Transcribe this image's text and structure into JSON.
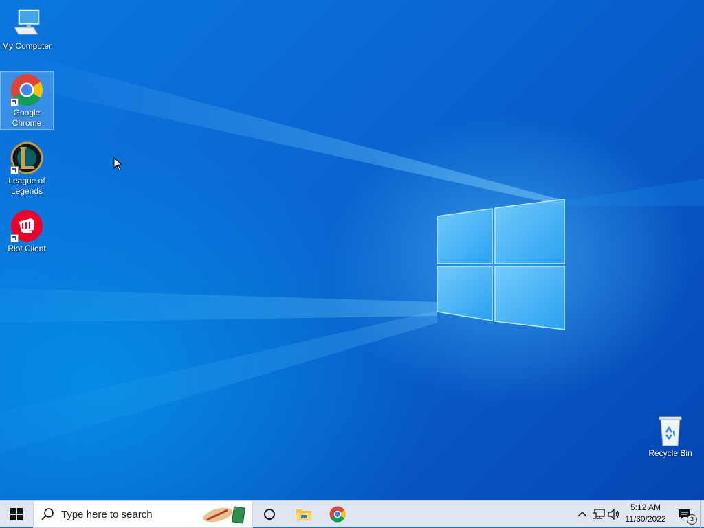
{
  "desktop": {
    "icons": [
      {
        "label": "My Computer",
        "icon": "computer-icon"
      },
      {
        "label": "Google Chrome",
        "icon": "chrome-icon",
        "selected": true
      },
      {
        "label": "League of Legends",
        "icon": "league-of-legends-icon"
      },
      {
        "label": "Riot Client",
        "icon": "riot-client-icon"
      },
      {
        "label": "Recycle Bin",
        "icon": "recycle-bin-icon"
      }
    ]
  },
  "taskbar": {
    "search_placeholder": "Type here to search",
    "pinned": [
      {
        "icon": "cortana-icon"
      },
      {
        "icon": "file-explorer-icon"
      },
      {
        "icon": "chrome-icon"
      }
    ],
    "clock": {
      "time": "5:12 AM",
      "date": "11/30/2022"
    },
    "notification_count": "3"
  },
  "colors": {
    "wallpaper": "#0a6fd6",
    "taskbar": "#dfe6ef",
    "chrome_red": "#db4437",
    "chrome_yellow": "#f4c20d",
    "chrome_green": "#0f9d58",
    "chrome_blue": "#4285f4",
    "riot_red": "#eb0029"
  }
}
